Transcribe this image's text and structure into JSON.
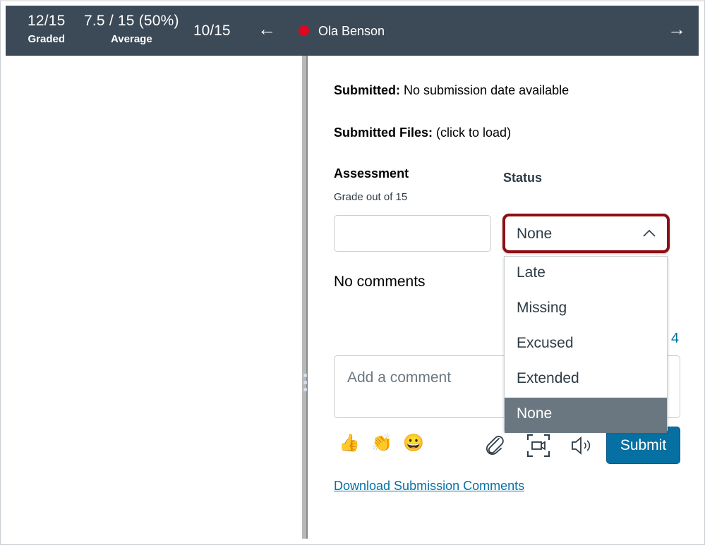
{
  "header": {
    "graded": {
      "value": "12/15",
      "label": "Graded"
    },
    "average": {
      "value": "7.5 / 15 (50%)",
      "label": "Average"
    },
    "position": "10/15",
    "prev_arrow": "←",
    "next_arrow": "→",
    "student_name": "Ola Benson",
    "status_dot_color": "#e0061f"
  },
  "submission": {
    "submitted_label": "Submitted:",
    "submitted_value": "No submission date available",
    "files_label": "Submitted Files:",
    "files_value": "(click to load)"
  },
  "assessment": {
    "title": "Assessment",
    "subtitle": "Grade out of 15",
    "grade_value": ""
  },
  "status": {
    "title": "Status",
    "selected": "None",
    "options": [
      "Late",
      "Missing",
      "Excused",
      "Extended",
      "None"
    ],
    "highlighted_option": "None"
  },
  "comments": {
    "empty_text": "No comments",
    "count_fragment": "4",
    "placeholder": "Add a comment",
    "emojis": [
      "👍",
      "👏",
      "😀"
    ],
    "emoji_names": [
      "thumbs-up",
      "clapping-hands",
      "grinning-face"
    ],
    "submit_label": "Submit",
    "download_label": "Download Submission Comments"
  },
  "colors": {
    "header_bg": "#3c4a58",
    "accent": "#0770a3",
    "highlight_border": "#8c0f14",
    "selected_option_bg": "#6b7780"
  }
}
